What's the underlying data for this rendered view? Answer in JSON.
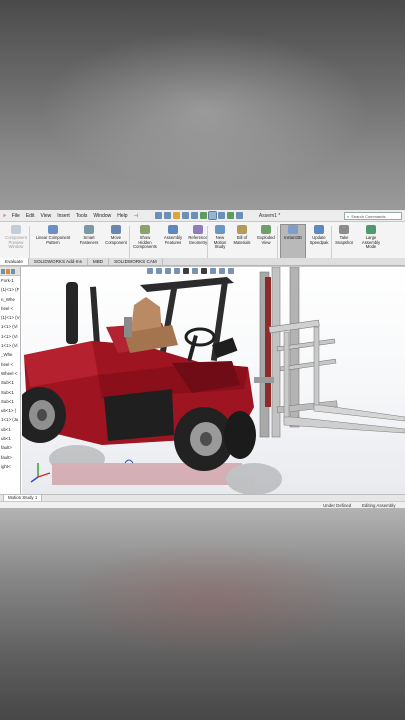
{
  "menu": {
    "items": [
      "File",
      "Edit",
      "View",
      "Insert",
      "Tools",
      "Window",
      "Help"
    ],
    "document": "Assem1 *",
    "search_placeholder": "Search Commands"
  },
  "ribbon": {
    "buttons": [
      {
        "label": "Component\nPreview\nWindow",
        "icon": "preview-window-icon",
        "color": "#8aa0b8",
        "disabled": true
      },
      {
        "label": "Linear Component\nPattern",
        "icon": "pattern-icon",
        "color": "#6a8fc4",
        "disabled": false
      },
      {
        "label": "Smart\nFasteners",
        "icon": "fastener-icon",
        "color": "#7b9aa8",
        "disabled": false
      },
      {
        "label": "Move\nComponent",
        "icon": "move-component-icon",
        "color": "#6c86b2",
        "disabled": false
      },
      {
        "label": "Show\nHidden\nComponents",
        "icon": "show-hidden-icon",
        "color": "#8ba36a",
        "disabled": false
      },
      {
        "label": "Assembly\nFeatures",
        "icon": "assembly-features-icon",
        "color": "#5f86c0",
        "disabled": false
      },
      {
        "label": "Reference\nGeometry",
        "icon": "reference-geometry-icon",
        "color": "#8f7dc0",
        "disabled": false
      },
      {
        "label": "New\nMotion\nStudy",
        "icon": "motion-study-icon",
        "color": "#6b98c2",
        "disabled": false
      },
      {
        "label": "Bill of\nMaterials",
        "icon": "bom-icon",
        "color": "#b59a5a",
        "disabled": false
      },
      {
        "label": "Exploded\nView",
        "icon": "exploded-view-icon",
        "color": "#6ea06e",
        "disabled": false
      },
      {
        "label": "Instant3D",
        "icon": "instant3d-icon",
        "color": "#7c9ec9",
        "disabled": false,
        "active": true
      },
      {
        "label": "Update\nSpeedpak",
        "icon": "speedpak-icon",
        "color": "#5d89c3",
        "disabled": false
      },
      {
        "label": "Take\nSnapshot",
        "icon": "snapshot-icon",
        "color": "#8c8c8c",
        "disabled": false
      },
      {
        "label": "Large\nAssembly\nMode",
        "icon": "large-assembly-icon",
        "color": "#4f9a6a",
        "disabled": false
      }
    ]
  },
  "tabs": [
    "Evaluate",
    "SOLIDWORKS Add-Ins",
    "MBD",
    "SOLIDWORKS CAM"
  ],
  "active_tab": "Evaluate",
  "feature_tree": {
    "rows": [
      "Fork-1",
      "(1)<1> (F",
      "n_Whe",
      "heel <",
      "(1)<1> (V",
      "1<1> (Vi",
      "1<1> (Vi",
      "1<1> (Vi",
      "_Whe",
      "heel <",
      "Wheel <",
      "Sub<1",
      "Sub<1",
      "Sub<1",
      "ub<1> (",
      "1<1> (Ju",
      "ub<1",
      "ub<1",
      "fault>",
      "fault>",
      "ight<"
    ]
  },
  "motion_tab": "Motion Study 1",
  "status": {
    "state": "Under Defined",
    "mode": "Editing Assembly"
  },
  "colors": {
    "body_red": "#9e1420",
    "mast_gray": "#b8b8b8",
    "seat_tan": "#b98a63",
    "tire_black": "#222222"
  }
}
